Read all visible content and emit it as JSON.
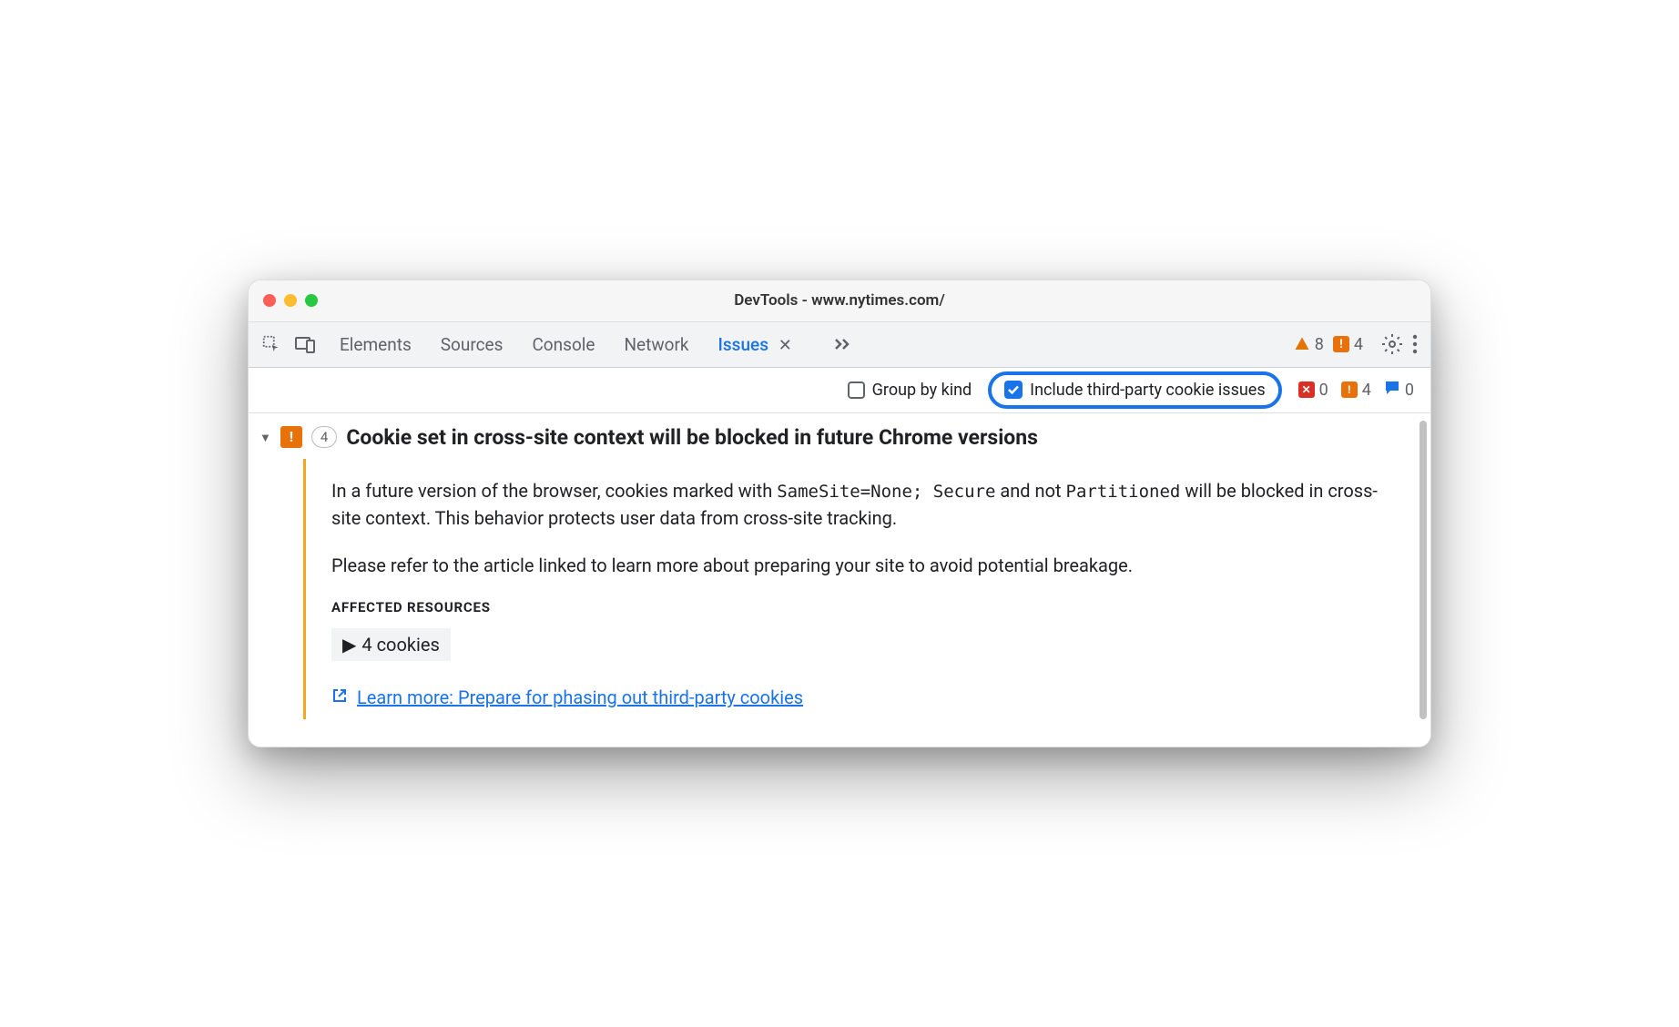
{
  "window": {
    "title": "DevTools - www.nytimes.com/"
  },
  "tabs": {
    "items": [
      "Elements",
      "Sources",
      "Console",
      "Network",
      "Issues"
    ],
    "active": "Issues"
  },
  "toolbar_badges": {
    "warning_count": "8",
    "issue_count": "4"
  },
  "subtoolbar": {
    "group_by_kind_label": "Group by kind",
    "group_by_kind_checked": false,
    "include_third_party_label": "Include third-party cookie issues",
    "include_third_party_checked": true,
    "counts": {
      "red": "0",
      "orange": "4",
      "blue": "0"
    }
  },
  "issue": {
    "count": "4",
    "title": "Cookie set in cross-site context will be blocked in future Chrome versions",
    "body_pre": "In a future version of the browser, cookies marked with ",
    "code1": "SameSite=None; Secure",
    "body_mid": " and not ",
    "code2": "Partitioned",
    "body_post": " will be blocked in cross-site context. This behavior protects user data from cross-site tracking.",
    "body2": "Please refer to the article linked to learn more about preparing your site to avoid potential breakage.",
    "affected_label": "AFFECTED RESOURCES",
    "cookies_chip": "4 cookies",
    "learn_more": "Learn more: Prepare for phasing out third-party cookies"
  }
}
